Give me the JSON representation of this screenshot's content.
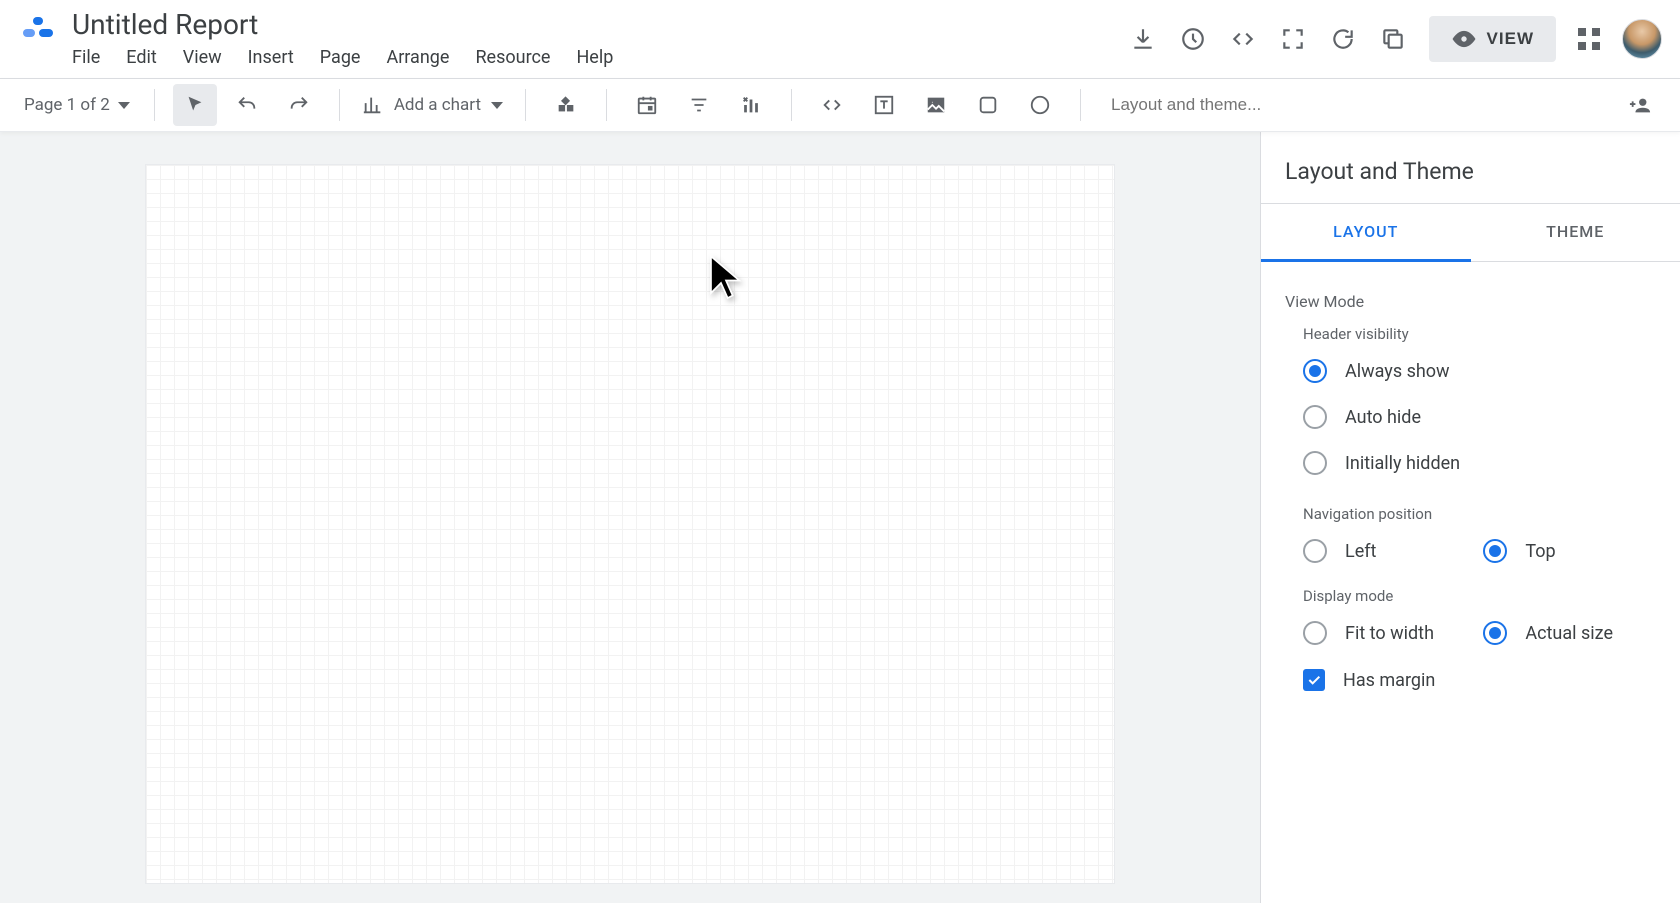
{
  "doc_title": "Untitled Report",
  "menu": {
    "file": "File",
    "edit": "Edit",
    "view": "View",
    "insert": "Insert",
    "page": "Page",
    "arrange": "Arrange",
    "resource": "Resource",
    "help": "Help"
  },
  "header_buttons": {
    "view": "VIEW"
  },
  "toolbar": {
    "page_label": "Page 1 of 2",
    "add_chart": "Add a chart",
    "layout_placeholder": "Layout and theme..."
  },
  "panel": {
    "title": "Layout and Theme",
    "tabs": {
      "layout": "LAYOUT",
      "theme": "THEME"
    },
    "view_mode": "View Mode",
    "header_visibility": "Header visibility",
    "hv_options": {
      "always": "Always show",
      "auto": "Auto hide",
      "initial": "Initially hidden"
    },
    "nav_position": "Navigation position",
    "nav_options": {
      "left": "Left",
      "top": "Top"
    },
    "display_mode": "Display mode",
    "dm_options": {
      "fit": "Fit to width",
      "actual": "Actual size"
    },
    "has_margin": "Has margin"
  }
}
